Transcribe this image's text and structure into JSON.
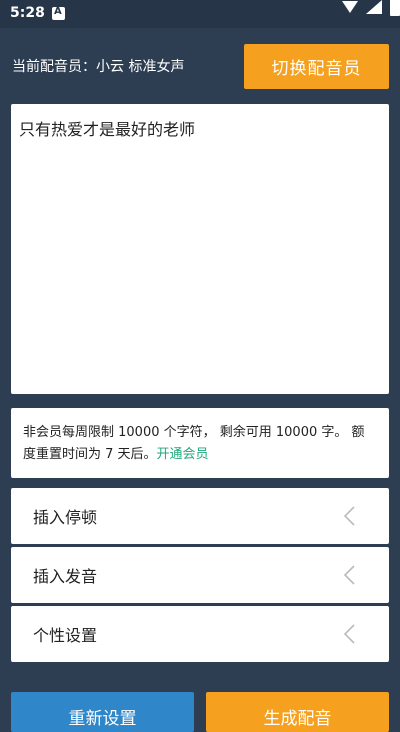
{
  "status_bar": {
    "time": "5:28"
  },
  "header": {
    "current_voice": "当前配音员：小云 标准女声",
    "switch_button": "切换配音员"
  },
  "editor": {
    "text": "只有热爱才是最好的老师"
  },
  "limit_notice": {
    "text": "非会员每周限制 10000 个字符， 剩余可用 10000 字。 额度重置时间为 7 天后。",
    "link": "开通会员"
  },
  "menu": [
    {
      "label": "插入停顿"
    },
    {
      "label": "插入发音"
    },
    {
      "label": "个性设置"
    }
  ],
  "actions": {
    "reset": "重新设置",
    "generate": "生成配音"
  },
  "colors": {
    "background": "#2d3e52",
    "accent_orange": "#f5a01e",
    "accent_blue": "#2f86c9",
    "link_green": "#21a87a"
  }
}
